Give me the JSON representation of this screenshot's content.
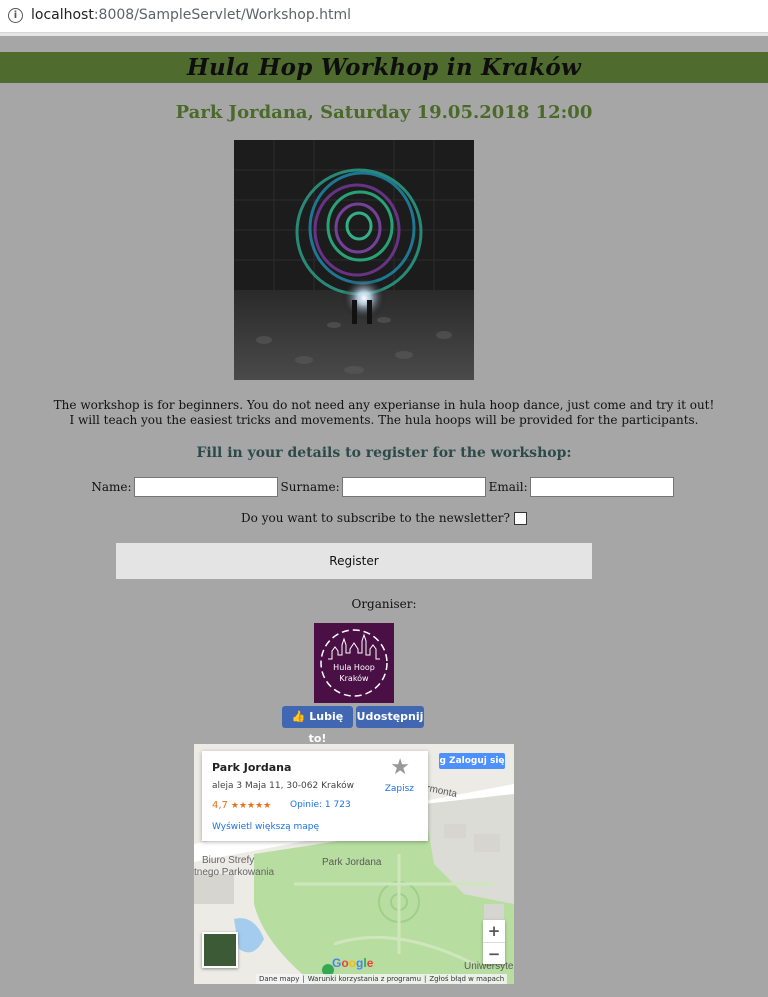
{
  "browser": {
    "url_host": "localhost",
    "url_port": ":8008",
    "url_path": "/SampleServlet/Workshop.html"
  },
  "page": {
    "title": "Hula Hop Workhop in Kraków",
    "subtitle": "Park Jordana, Saturday 19.05.2018 12:00",
    "description_line1": "The workshop is for beginners. You do not need any experianse in hula hoop dance, just come and try it out!",
    "description_line2": "I will teach you the easiest tricks and movements. The hula hoops will be provided for the participants.",
    "register_heading": "Fill in your details to register for the workshop:"
  },
  "form": {
    "name_label": "Name:",
    "name_value": "",
    "surname_label": "Surname:",
    "surname_value": "",
    "email_label": "Email:",
    "email_value": "",
    "newsletter_label": "Do you want to subscribe to the newsletter?",
    "newsletter_checked": false,
    "register_button": "Register"
  },
  "organizer": {
    "label": "Organiser:",
    "logo_text_1": "Hula Hoop",
    "logo_text_2": "Kraków"
  },
  "facebook": {
    "like_label": "Lubię to!",
    "share_label": "Udostępnij"
  },
  "map": {
    "place_name": "Park Jordana",
    "address": "aleja 3 Maja 11, 30-062 Kraków",
    "rating": "4,7",
    "reviews": "Opinie: 1 723",
    "save_label": "Zapisz",
    "larger_map": "Wyświetl większą mapę",
    "login_label": "Zaloguj się",
    "label_park": "Park Jordana",
    "label_biuro_1": "Biuro Strefy",
    "label_biuro_2": "tnego Parkowania",
    "label_street": "rmonta",
    "label_uni": "Uniwersyte",
    "zoom_in": "+",
    "zoom_out": "−",
    "footer_data": "Dane mapy",
    "footer_terms": "Warunki korzystania z programu",
    "footer_report": "Zgłoś błąd w mapach",
    "google_logo": "Google"
  },
  "colors": {
    "background": "#a6a6a6",
    "banner": "#4f6b2e",
    "subtitle": "#4a6a2a",
    "register_heading": "#2c4a4a",
    "facebook": "#4267b2",
    "logo_bg": "#4a1045"
  }
}
